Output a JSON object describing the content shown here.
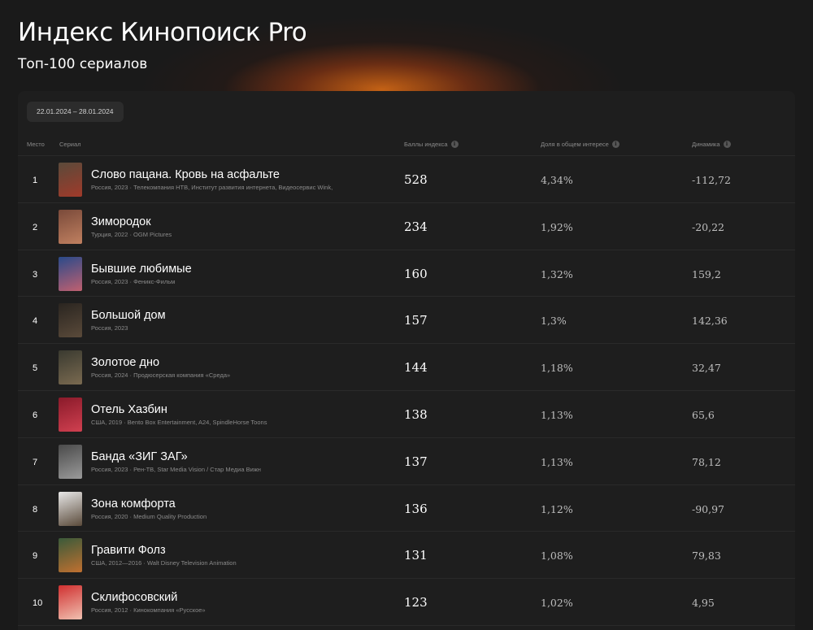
{
  "header": {
    "title": "Индекс Кинопоиск Pro",
    "subtitle": "Топ-100 сериалов"
  },
  "filter": {
    "date_range": "22.01.2024 – 28.01.2024"
  },
  "table": {
    "columns": {
      "place": "Место",
      "series": "Сериал",
      "score": "Баллы индекса",
      "share": "Доля в общем интересе",
      "dynamics": "Динамика"
    },
    "rows": [
      {
        "rank": "1",
        "title": "Слово пацана. Кровь на асфальте",
        "meta": "Россия, 2023 · Телекомпания НТВ, Институт развития интернета, Видеосервис Wink,",
        "score": "528",
        "share": "4,34%",
        "dynamics": "-112,72",
        "poster_colors": [
          "#5a4a3a",
          "#a03a2a"
        ]
      },
      {
        "rank": "2",
        "title": "Зимородок",
        "meta": "Турция, 2022 · OGM Pictures",
        "score": "234",
        "share": "1,92%",
        "dynamics": "-20,22",
        "poster_colors": [
          "#7a4a3a",
          "#c08060"
        ]
      },
      {
        "rank": "3",
        "title": "Бывшие любимые",
        "meta": "Россия, 2023 · Феникс-Фильм",
        "score": "160",
        "share": "1,32%",
        "dynamics": "159,2",
        "poster_colors": [
          "#2a4a8a",
          "#c06070"
        ]
      },
      {
        "rank": "4",
        "title": "Большой дом",
        "meta": "Россия, 2023",
        "score": "157",
        "share": "1,3%",
        "dynamics": "142,36",
        "poster_colors": [
          "#2a2520",
          "#5a4a3a"
        ]
      },
      {
        "rank": "5",
        "title": "Золотое дно",
        "meta": "Россия, 2024 · Продюсерская компания «Среда»",
        "score": "144",
        "share": "1,18%",
        "dynamics": "32,47",
        "poster_colors": [
          "#3a3a30",
          "#7a6a50"
        ]
      },
      {
        "rank": "6",
        "title": "Отель Хазбин",
        "meta": "США, 2019 · Bento Box Entertainment, A24, SpindleHorse Toons",
        "score": "138",
        "share": "1,13%",
        "dynamics": "65,6",
        "poster_colors": [
          "#8a1a2a",
          "#d04050"
        ]
      },
      {
        "rank": "7",
        "title": "Банда «ЗИГ ЗАГ»",
        "meta": "Россия, 2023 · Рен-ТВ, Star Media Vision / Стар Медиа Вижн",
        "score": "137",
        "share": "1,13%",
        "dynamics": "78,12",
        "poster_colors": [
          "#4a4a4a",
          "#9a9a9a"
        ]
      },
      {
        "rank": "8",
        "title": "Зона комфорта",
        "meta": "Россия, 2020 · Medium Quality Production",
        "score": "136",
        "share": "1,12%",
        "dynamics": "-90,97",
        "poster_colors": [
          "#e8e8e8",
          "#5a4a3a"
        ]
      },
      {
        "rank": "9",
        "title": "Гравити Фолз",
        "meta": "США, 2012—2016 · Walt Disney Television Animation",
        "score": "131",
        "share": "1,08%",
        "dynamics": "79,83",
        "poster_colors": [
          "#3a5a3a",
          "#c07030"
        ]
      },
      {
        "rank": "10",
        "title": "Склифосовский",
        "meta": "Россия, 2012 · Кинокомпания «Русское»",
        "score": "123",
        "share": "1,02%",
        "dynamics": "4,95",
        "poster_colors": [
          "#d03030",
          "#f0c0b0"
        ]
      }
    ]
  }
}
